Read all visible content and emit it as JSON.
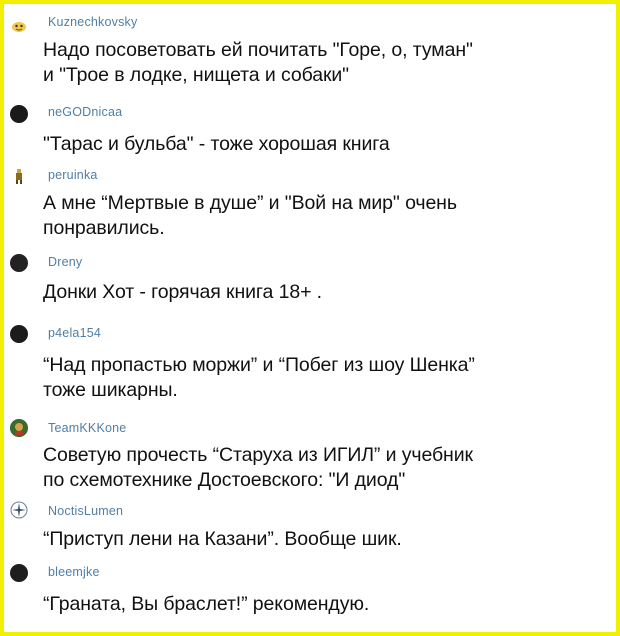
{
  "comments": [
    {
      "username": "Kuznechkovsky",
      "avatar": "cartoon-avatar-icon",
      "text": "Надо посоветовать ей почитать \"Горе, о, туман\"\nи \"Трое в лодке, нищета и собаки\""
    },
    {
      "username": "neGODnicaa",
      "avatar": "user-avatar",
      "text": "\"Тарас и бульба\" - тоже хорошая книга"
    },
    {
      "username": "peruinka",
      "avatar": "figure-avatar-icon",
      "text": "А мне “Мертвые в душе” и \"Вой на мир\" очень\nпонравились."
    },
    {
      "username": "Dreny",
      "avatar": "user-avatar",
      "text": "Донки Хот - горячая книга 18+ ."
    },
    {
      "username": "p4ela154",
      "avatar": "user-avatar",
      "text": "“Над пропастью моржи” и “Побег из шоу Шенка”\nтоже шикарны."
    },
    {
      "username": "TeamKKKone",
      "avatar": "character-avatar-icon",
      "text": "Советую прочесть  “Старуха из ИГИЛ”  и учебник\nпо схемотехнике Достоевского: \"И диод\""
    },
    {
      "username": "NoctisLumen",
      "avatar": "star-avatar-icon",
      "text": "“Приступ лени на Казани”. Вообще шик."
    },
    {
      "username": "bleemjke",
      "avatar": "user-avatar",
      "text": "“Граната, Вы браслет!” рекомендую."
    }
  ]
}
